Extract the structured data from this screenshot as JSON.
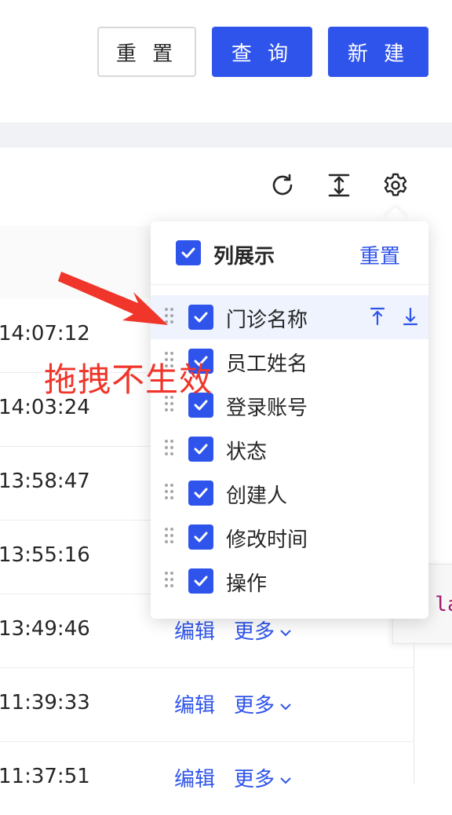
{
  "toolbar": {
    "reset_label": "重 置",
    "query_label": "查 询",
    "new_label": "新 建"
  },
  "table_tools": {
    "icons": [
      "reload-icon",
      "density-icon",
      "gear-icon"
    ]
  },
  "rows": [
    {
      "time": "14:07:12",
      "edit": "",
      "more": ""
    },
    {
      "time": "14:03:24",
      "edit": "",
      "more": ""
    },
    {
      "time": "13:58:47",
      "edit": "",
      "more": ""
    },
    {
      "time": "13:55:16",
      "edit": "",
      "more": ""
    },
    {
      "time": "13:49:46",
      "edit": "编辑",
      "more": "更多"
    },
    {
      "time": "11:39:33",
      "edit": "编辑",
      "more": "更多"
    },
    {
      "time": "11:37:51",
      "edit": "编辑",
      "more": "更多"
    }
  ],
  "column_settings": {
    "title": "列展示",
    "reset_label": "重置",
    "items": [
      {
        "label": "门诊名称",
        "checked": true
      },
      {
        "label": "员工姓名",
        "checked": true
      },
      {
        "label": "登录账号",
        "checked": true
      },
      {
        "label": "状态",
        "checked": true
      },
      {
        "label": "创建人",
        "checked": true
      },
      {
        "label": "修改时间",
        "checked": true
      },
      {
        "label": "操作",
        "checked": true
      }
    ]
  },
  "code_snippet": "{ la",
  "annotation": {
    "text": "拖拽不生效",
    "color": "#f0352a"
  },
  "colors": {
    "primary": "#2f54eb",
    "row_highlight": "#eef3fd",
    "band": "#f0f2f5"
  }
}
